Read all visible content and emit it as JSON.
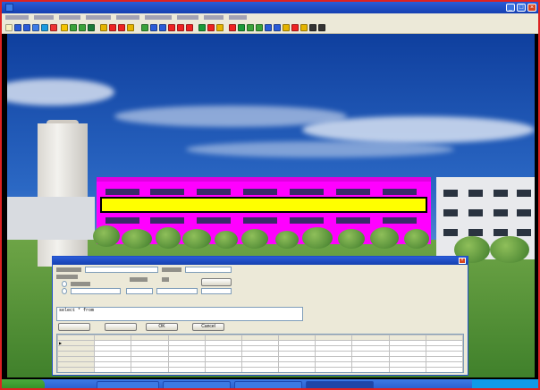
{
  "window": {
    "title": "",
    "controls": {
      "minimize": "_",
      "maximize": "□",
      "close": "×"
    }
  },
  "menubar": {
    "items": [
      "",
      "",
      "",
      "",
      "",
      "",
      "",
      "",
      "",
      "",
      ""
    ]
  },
  "toolbar": {
    "buttons": [
      "",
      "",
      "",
      "",
      "",
      "",
      "",
      "",
      "",
      "",
      "",
      "",
      "",
      "",
      "",
      "",
      "",
      "",
      "",
      "",
      "",
      "",
      "",
      "",
      "",
      "",
      "",
      "",
      "",
      "",
      "",
      "",
      "",
      "",
      "",
      "",
      "",
      ""
    ]
  },
  "scene": {
    "highlight_color": "#ffff00",
    "building_color": "#ff00ff",
    "sky_color": "#2b68c4",
    "ground_color": "#4e8f34"
  },
  "dialog": {
    "title": "",
    "close_label": "×",
    "sql_text": "select  *  from  ",
    "buttons": {
      "query": "",
      "clear": "",
      "ok": "OK",
      "cancel": "Cancel"
    },
    "table": {
      "columns": [
        "",
        "",
        "",
        "",
        "",
        "",
        "",
        "",
        "",
        ""
      ],
      "rows": [
        [
          "",
          "",
          "",
          "",
          "",
          "",
          "",
          "",
          "",
          ""
        ],
        [
          "",
          "",
          "",
          "",
          "",
          "",
          "",
          "",
          "",
          ""
        ],
        [
          "",
          "",
          "",
          "",
          "",
          "",
          "",
          "",
          "",
          ""
        ],
        [
          "",
          "",
          "",
          "",
          "",
          "",
          "",
          "",
          "",
          ""
        ],
        [
          "",
          "",
          "",
          "",
          "",
          "",
          "",
          "",
          "",
          ""
        ],
        [
          "",
          "",
          "",
          "",
          "",
          "",
          "",
          "",
          "",
          ""
        ]
      ]
    }
  },
  "taskbar": {
    "start_label": "",
    "tasks": [
      "",
      "",
      "",
      "",
      ""
    ],
    "clock": ""
  }
}
